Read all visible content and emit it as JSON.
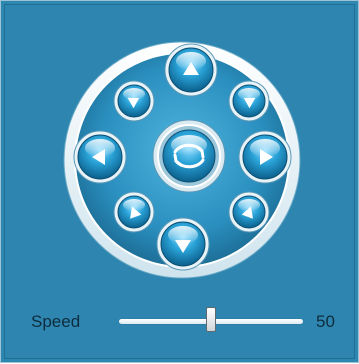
{
  "ptz_control": {
    "buttons": [
      {
        "name": "pan-up-button",
        "icon": "arrow-up-icon"
      },
      {
        "name": "pan-down-button",
        "icon": "arrow-down-icon"
      },
      {
        "name": "pan-left-button",
        "icon": "arrow-left-icon"
      },
      {
        "name": "pan-right-button",
        "icon": "arrow-right-icon"
      },
      {
        "name": "pan-up-left-button",
        "icon": "arrow-up-left-icon"
      },
      {
        "name": "pan-up-right-button",
        "icon": "arrow-up-right-icon"
      },
      {
        "name": "pan-down-left-button",
        "icon": "arrow-down-left-icon"
      },
      {
        "name": "pan-down-right-button",
        "icon": "arrow-down-right-icon"
      },
      {
        "name": "auto-rotate-button",
        "icon": "rotate-icon"
      }
    ]
  },
  "speed": {
    "label": "Speed",
    "value": "50",
    "fraction": 0.5
  },
  "colors": {
    "background": "#2e86b0",
    "button_blue": "#1e8fc4",
    "ring_white": "#eef6fa",
    "label_text": "#0e2c3d"
  }
}
